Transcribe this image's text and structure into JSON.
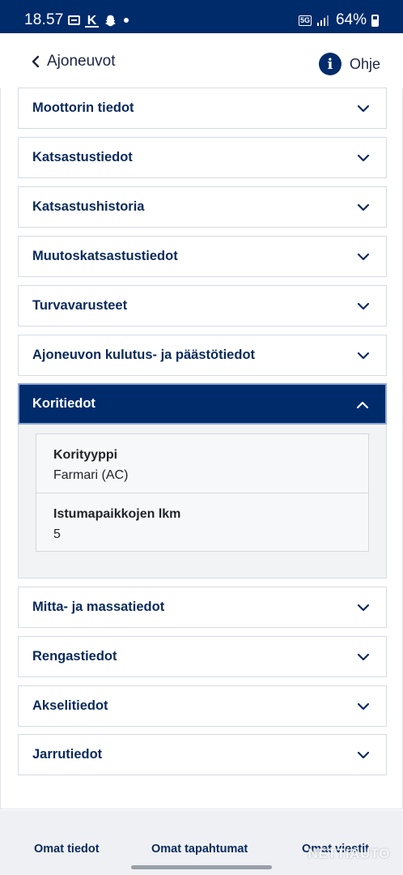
{
  "status_bar": {
    "time": "18.57",
    "network": "5G",
    "battery": "64%"
  },
  "header": {
    "back_label": "Ajoneuvot",
    "help_label": "Ohje"
  },
  "sections": [
    {
      "label": "Moottorin tiedot",
      "expanded": false
    },
    {
      "label": "Katsastustiedot",
      "expanded": false
    },
    {
      "label": "Katsastushistoria",
      "expanded": false
    },
    {
      "label": "Muutoskatsastustiedot",
      "expanded": false
    },
    {
      "label": "Turvavarusteet",
      "expanded": false
    },
    {
      "label": "Ajoneuvon kulutus- ja päästötiedot",
      "expanded": false
    },
    {
      "label": "Koritiedot",
      "expanded": true
    },
    {
      "label": "Mitta- ja massatiedot",
      "expanded": false
    },
    {
      "label": "Rengastiedot",
      "expanded": false
    },
    {
      "label": "Akselitiedot",
      "expanded": false
    },
    {
      "label": "Jarrutiedot",
      "expanded": false
    }
  ],
  "koritiedot_details": [
    {
      "key": "Korityyppi",
      "value": "Farmari (AC)"
    },
    {
      "key": "Istumapaikkojen lkm",
      "value": "5"
    }
  ],
  "bottom_nav": {
    "items": [
      "Omat tiedot",
      "Omat tapahtumat",
      "Omat viestit"
    ]
  },
  "watermark": "NETTIAUTO",
  "colors": {
    "brand_navy": "#002b6b",
    "label_text": "#0a2a5c",
    "panel_bg": "#f2f3f5"
  }
}
